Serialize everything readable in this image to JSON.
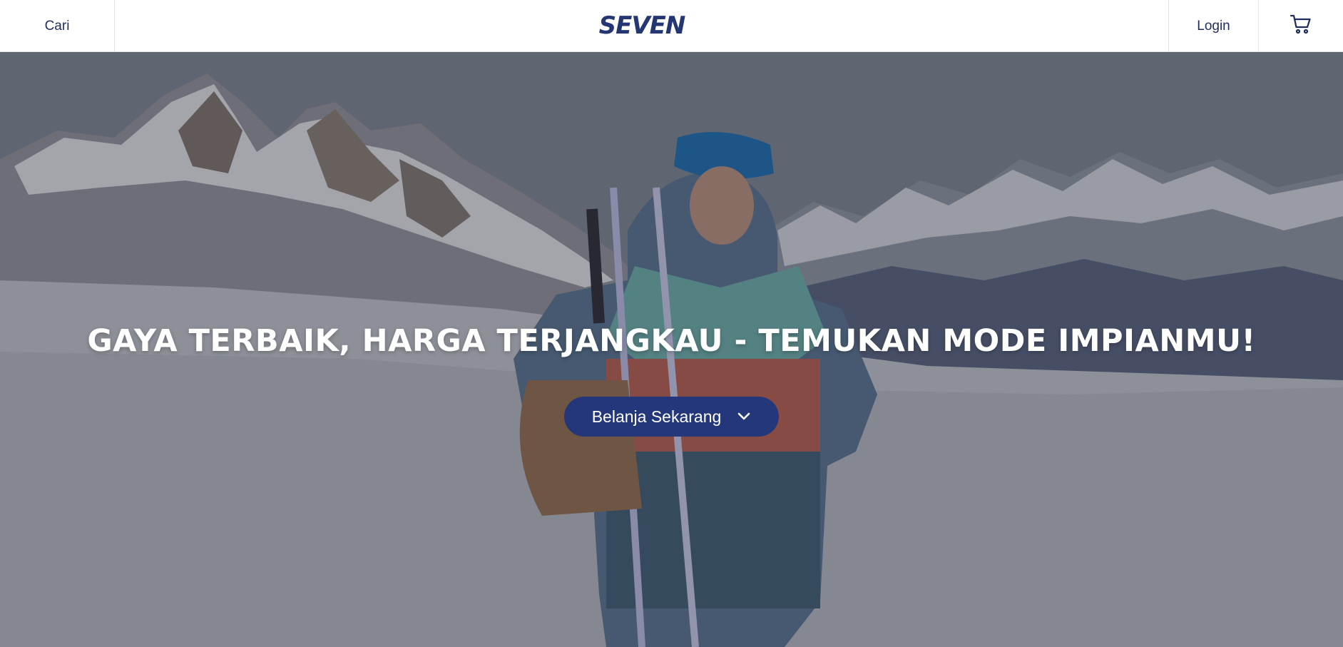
{
  "header": {
    "search_label": "Cari",
    "logo_text": "SEVEN",
    "login_label": "Login",
    "cart_icon": "cart-icon"
  },
  "hero": {
    "headline": "GAYA TERBAIK, HARGA TERJANGKAU - TEMUKAN MODE IMPIANMU!",
    "cta_label": "Belanja Sekarang",
    "cta_icon": "chevron-down-icon"
  },
  "colors": {
    "brand": "#243772",
    "button_bg": "#23377a",
    "header_text": "#1f2d5a",
    "hero_text": "#ffffff"
  }
}
